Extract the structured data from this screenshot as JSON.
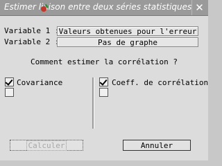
{
  "window": {
    "title": "Estimer liaison entre deux séries statistiques",
    "close_glyph": "✕"
  },
  "variables": [
    {
      "label": "Variable 1 :",
      "value": "Valeurs obtenues pour l'erreur"
    },
    {
      "label": "Variable 2 :",
      "value": "Pas de graphe"
    }
  ],
  "question": "Comment estimer la corrélation ?",
  "options": {
    "left": {
      "label": "Covariance",
      "checked": true
    },
    "right": {
      "label": "Coeff. de corrélation",
      "checked": true
    }
  },
  "buttons": {
    "calculate": {
      "label": "Calculer",
      "enabled": false
    },
    "cancel": {
      "label": "Annuler",
      "enabled": true
    }
  },
  "colors": {
    "titlebar": "#9a9a9a",
    "window_bg": "#dcdcdc",
    "badge_red": "#c0392b",
    "badge_green": "#2e8b3a"
  },
  "icons": {
    "close": "close-icon",
    "app": "app-badge-icon",
    "checkmark": "checkmark-icon"
  }
}
